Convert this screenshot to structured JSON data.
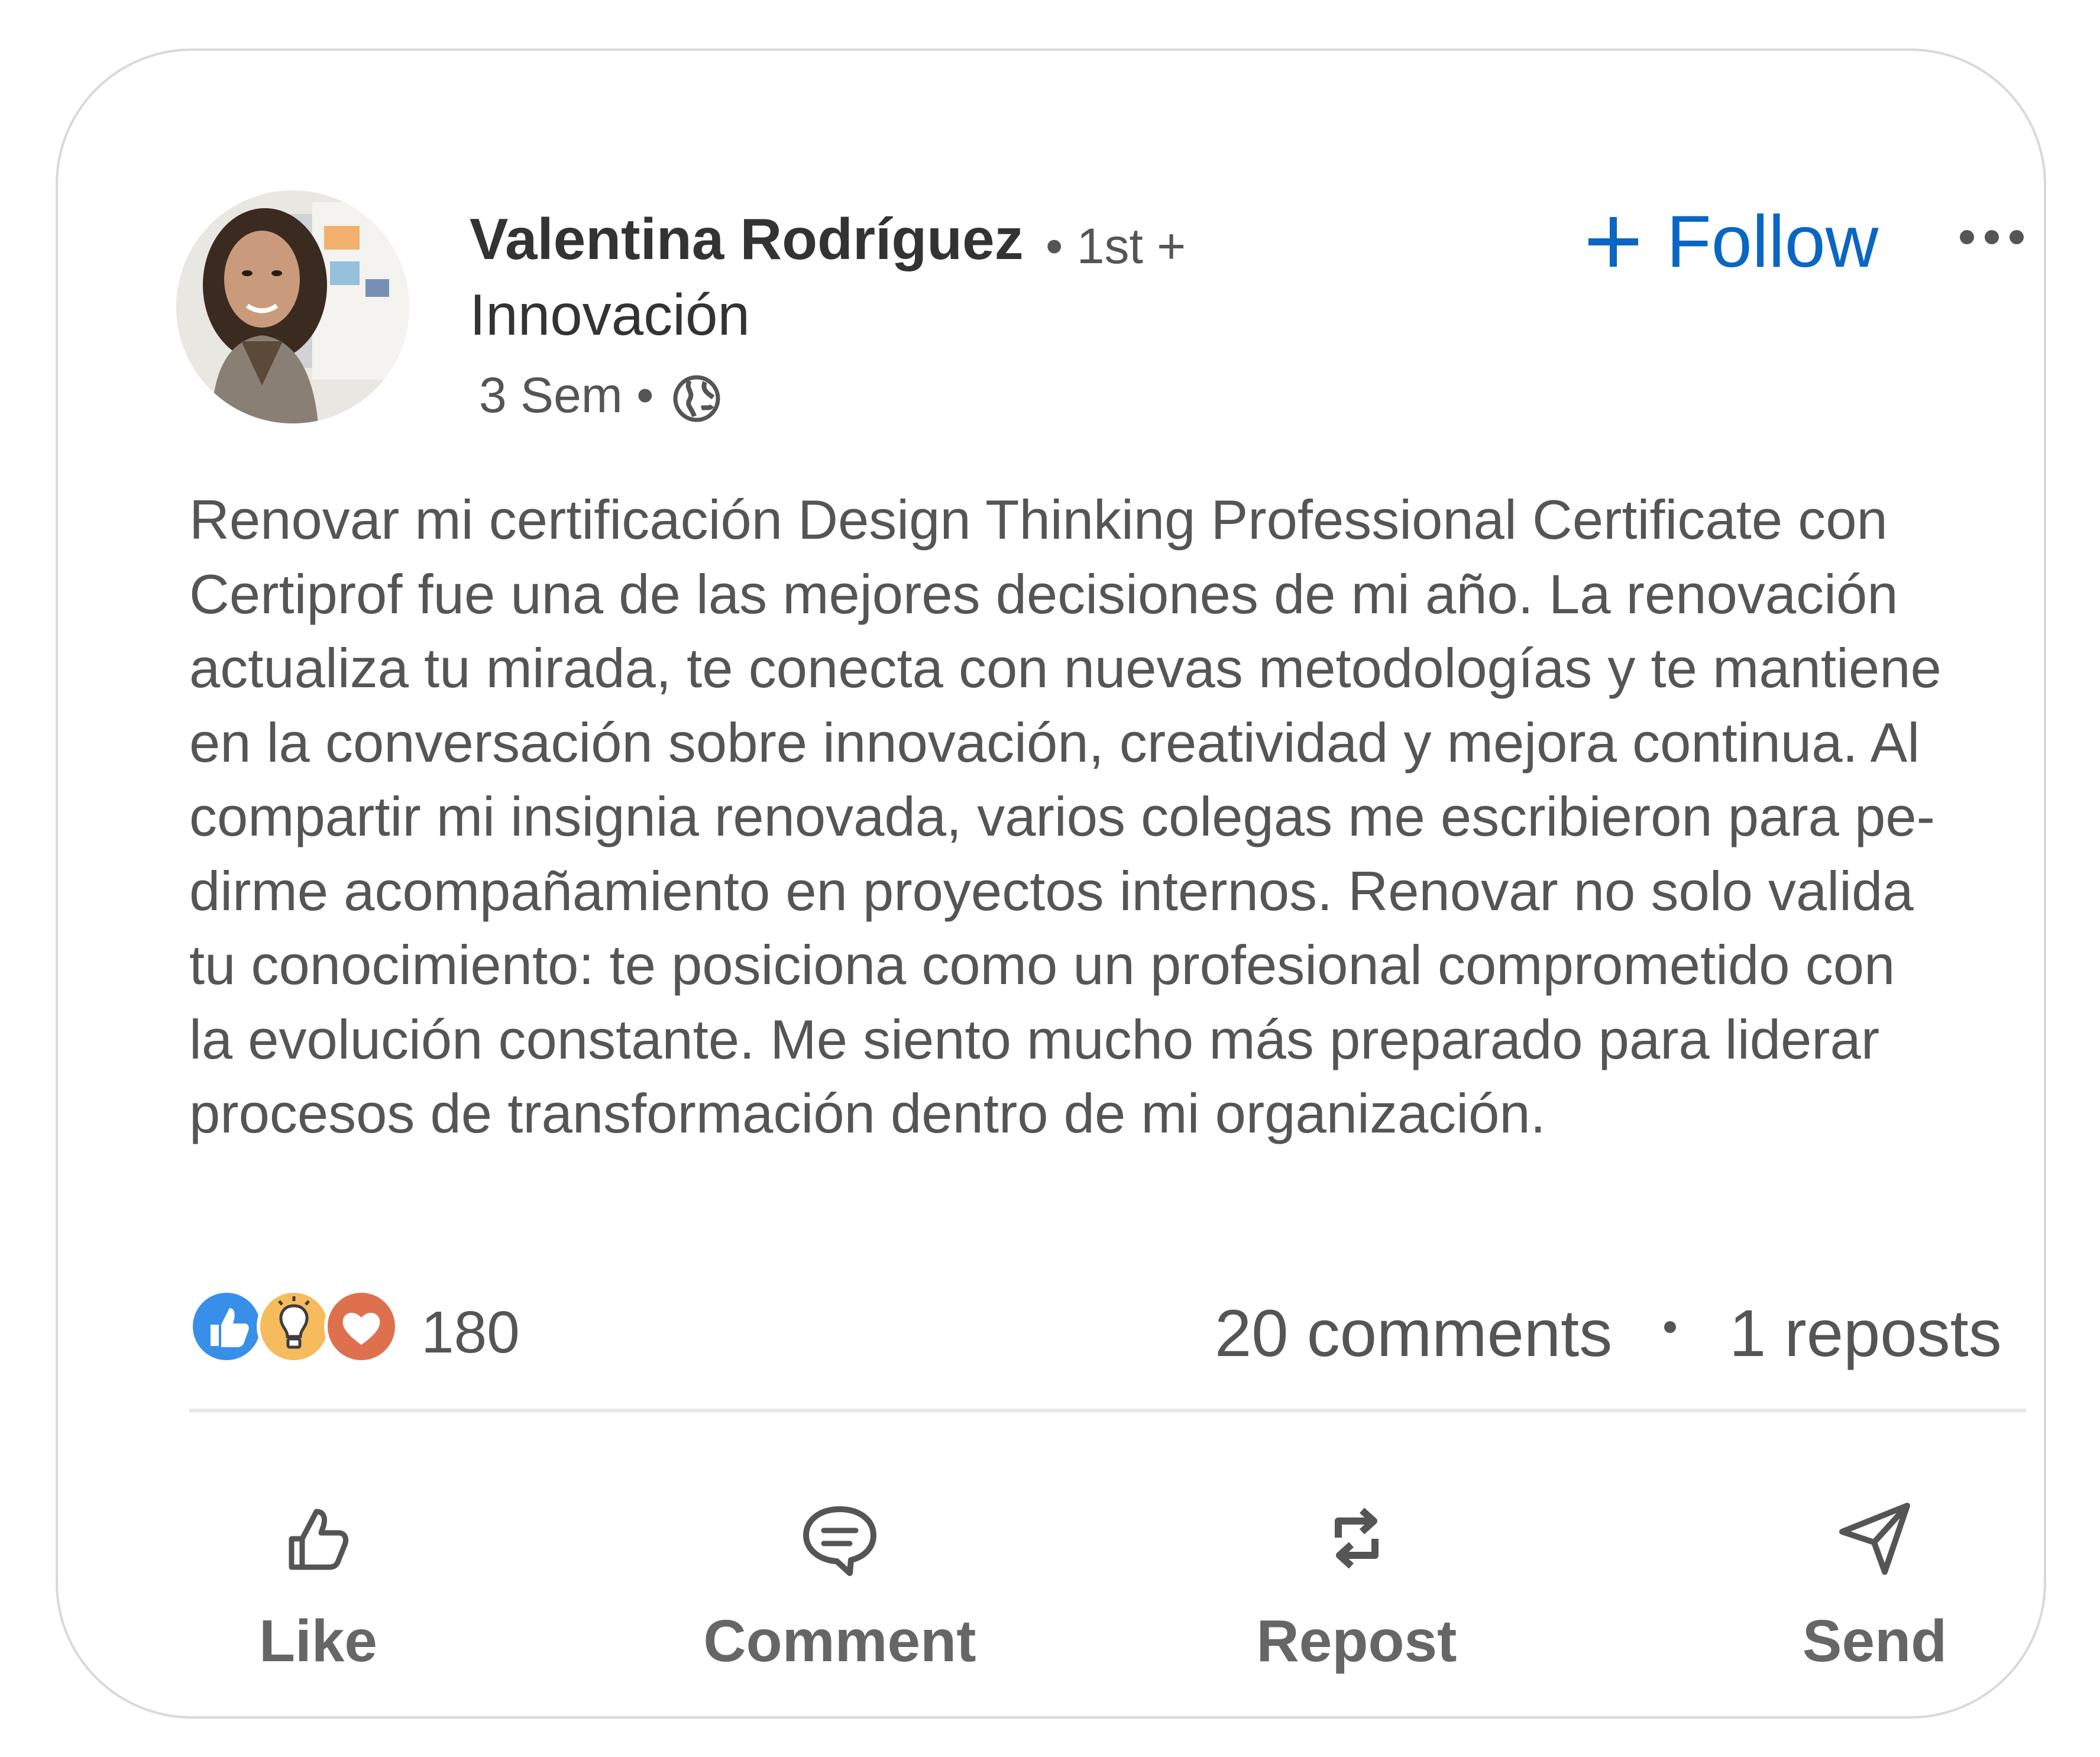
{
  "author": {
    "name": "Valentina Rodríguez",
    "degree": "• 1st +",
    "headline": "Innovación",
    "timestamp": "3 Sem •"
  },
  "follow": {
    "label": "Follow"
  },
  "post": {
    "lines": [
      "Renovar mi certificación Design Thinking Professional Certificate con",
      "Certiprof fue una de las mejores decisiones de mi año. La renovación",
      "actualiza tu mirada, te conecta con nuevas metodologías y te mantiene",
      "en la conversación sobre innovación, creatividad y mejora continua. Al",
      "compartir mi insignia renovada, varios colegas me escribieron para pe-",
      "dirme acompañamiento en proyectos internos. Renovar no solo valida",
      "tu conocimiento: te posiciona como un profesional comprometido con",
      "la evolución constante. Me siento mucho más preparado para liderar",
      "procesos de transformación dentro de mi organización."
    ]
  },
  "social": {
    "reaction_count": "180",
    "comments": "20  comments",
    "reposts": "1  reposts",
    "reaction_icons": [
      "like-icon",
      "insightful-icon",
      "love-icon"
    ]
  },
  "actions": {
    "like": "Like",
    "comment": "Comment",
    "repost": "Repost",
    "send": "Send"
  },
  "colors": {
    "accent": "#0a66c2",
    "text": "#555555",
    "like": "#378fe9",
    "insightful": "#f5bb5c",
    "love": "#df704d"
  }
}
